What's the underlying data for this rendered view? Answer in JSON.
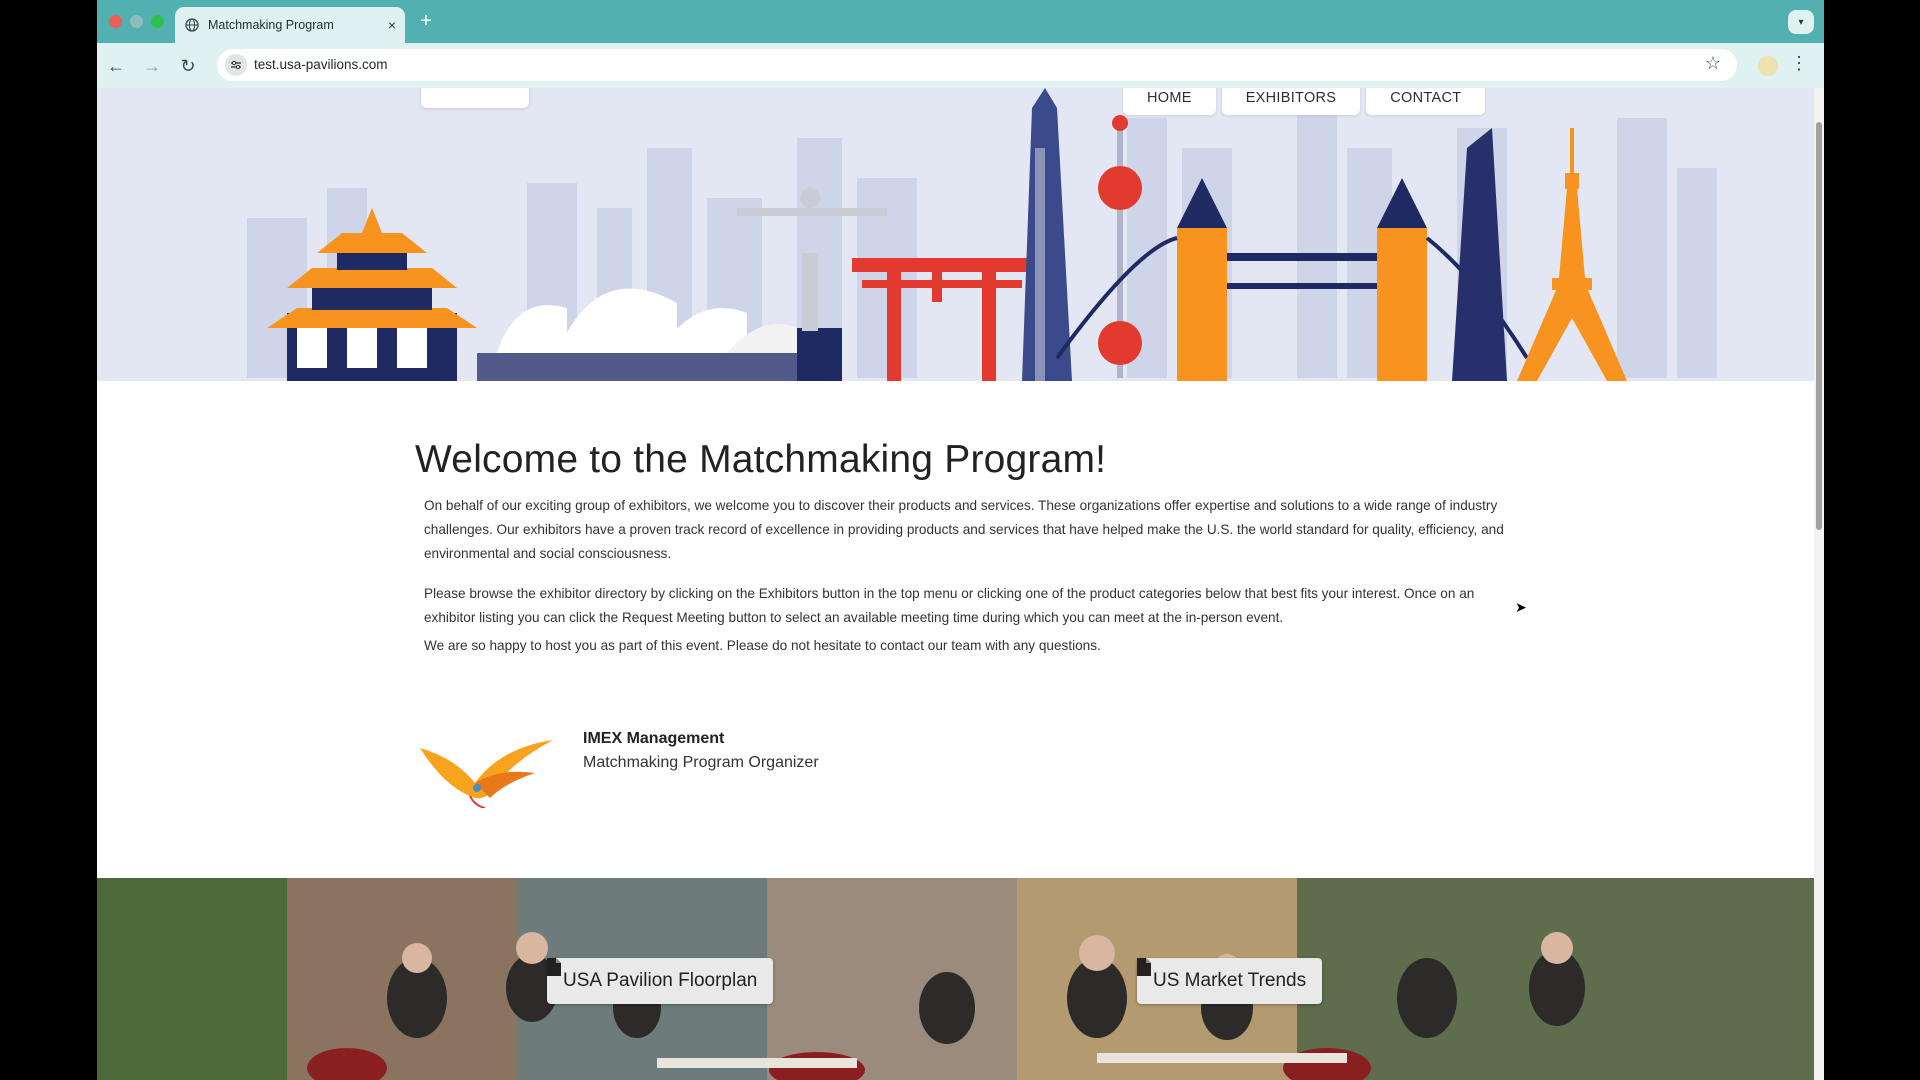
{
  "browser": {
    "tab_title": "Matchmaking Program",
    "close_tab": "×",
    "new_tab": "+",
    "url": "test.usa-pavilions.com"
  },
  "nav": {
    "items": [
      {
        "label": "HOME"
      },
      {
        "label": "EXHIBITORS"
      },
      {
        "label": "CONTACT"
      }
    ]
  },
  "main": {
    "heading": "Welcome to the Matchmaking Program!",
    "paragraphs": [
      "On behalf of our exciting group of exhibitors, we welcome you to discover their products and services. These organizations offer expertise and solutions to a wide range of industry challenges. Our exhibitors have a proven track record of excellence in providing products and services that have helped make the U.S. the world standard for quality, efficiency, and environmental and social consciousness.",
      "Please browse the exhibitor directory by clicking on the Exhibitors button in the top menu or clicking one of the product categories below that best fits your interest. Once on an exhibitor listing you can click the Request Meeting button to select an available meeting time during which you can meet at the in-person event.",
      "We are so happy to host you as part of this event. Please do not hesitate to contact our team with any questions."
    ]
  },
  "organizer": {
    "name": "IMEX Management",
    "role": "Matchmaking Program Organizer"
  },
  "buttons": {
    "floorplan": "USA Pavilion Floorplan",
    "market_trends": "US Market Trends"
  },
  "colors": {
    "tabbar": "#52b0b0",
    "toolbar": "#dff1f1",
    "hero_bg": "#e3e7f3",
    "accent_orange": "#f7931e",
    "accent_red": "#e23a2e",
    "navy": "#27306b"
  }
}
